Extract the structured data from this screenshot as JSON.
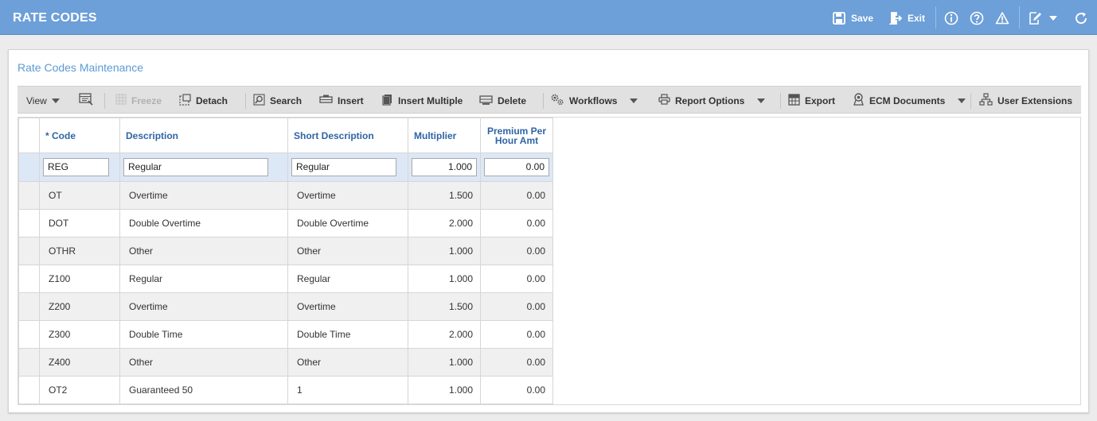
{
  "header": {
    "title": "RATE CODES",
    "save_label": "Save",
    "exit_label": "Exit"
  },
  "panel": {
    "title": "Rate Codes Maintenance"
  },
  "toolbar": {
    "view": "View",
    "freeze": "Freeze",
    "detach": "Detach",
    "search": "Search",
    "insert": "Insert",
    "insert_multiple": "Insert Multiple",
    "delete": "Delete",
    "workflows": "Workflows",
    "report_options": "Report Options",
    "export": "Export",
    "ecm_documents": "ECM Documents",
    "user_extensions": "User Extensions"
  },
  "columns": {
    "code": "* Code",
    "description": "Description",
    "short_description": "Short Description",
    "multiplier": "Multiplier",
    "premium_line1": "Premium Per",
    "premium_line2": "Hour Amt"
  },
  "rows": [
    {
      "code": "REG",
      "description": "Regular",
      "short_description": "Regular",
      "multiplier": "1.000",
      "premium": "0.00"
    },
    {
      "code": "OT",
      "description": "Overtime",
      "short_description": "Overtime",
      "multiplier": "1.500",
      "premium": "0.00"
    },
    {
      "code": "DOT",
      "description": "Double Overtime",
      "short_description": "Double Overtime",
      "multiplier": "2.000",
      "premium": "0.00"
    },
    {
      "code": "OTHR",
      "description": "Other",
      "short_description": "Other",
      "multiplier": "1.000",
      "premium": "0.00"
    },
    {
      "code": "Z100",
      "description": "Regular",
      "short_description": "Regular",
      "multiplier": "1.000",
      "premium": "0.00"
    },
    {
      "code": "Z200",
      "description": "Overtime",
      "short_description": "Overtime",
      "multiplier": "1.500",
      "premium": "0.00"
    },
    {
      "code": "Z300",
      "description": "Double Time",
      "short_description": "Double Time",
      "multiplier": "2.000",
      "premium": "0.00"
    },
    {
      "code": "Z400",
      "description": "Other",
      "short_description": "Other",
      "multiplier": "1.000",
      "premium": "0.00"
    },
    {
      "code": "OT2",
      "description": "Guaranteed 50",
      "short_description": "1",
      "multiplier": "1.000",
      "premium": "0.00"
    }
  ],
  "icons": {
    "save": "save-icon",
    "exit": "exit-icon",
    "info": "info-icon",
    "help": "help-icon",
    "warning": "warning-icon",
    "edit": "edit-icon",
    "refresh": "refresh-icon"
  },
  "colors": {
    "header_bg": "#6d9fd8",
    "panel_title": "#5b9bd5",
    "column_header": "#2f64a4",
    "selected_row": "#dde8f6"
  }
}
